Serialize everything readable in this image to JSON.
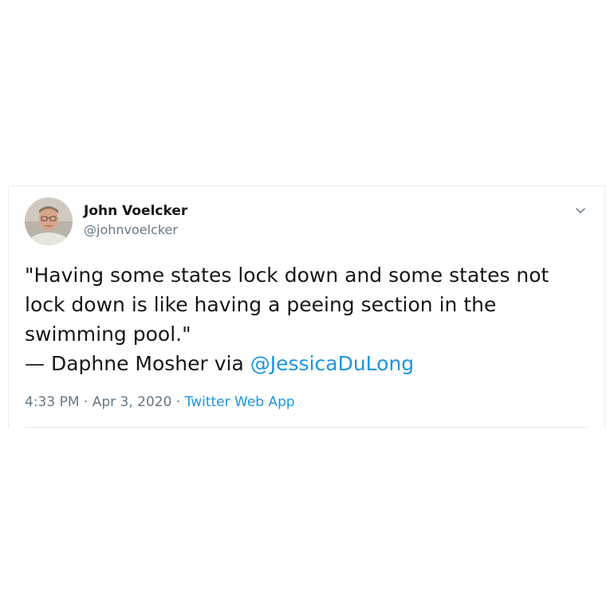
{
  "user": {
    "display_name": "John Voelcker",
    "handle": "@johnvoelcker"
  },
  "tweet": {
    "line1": "\"Having some states lock down and some states not",
    "line2": "lock down is like having a peeing section in the",
    "line3": "swimming pool.\"",
    "line4_prefix": "— Daphne Mosher via ",
    "mention": "@JessicaDuLong"
  },
  "meta": {
    "time": "4:33 PM",
    "separator1": " · ",
    "date": "Apr 3, 2020",
    "separator2": " · ",
    "source": "Twitter Web App"
  },
  "icons": {
    "caret": "chevron-down-icon",
    "avatar": "avatar"
  },
  "colors": {
    "link": "#1b95e0",
    "secondary_text": "#657786",
    "primary_text": "#14171a",
    "border": "#e6ecf0"
  }
}
